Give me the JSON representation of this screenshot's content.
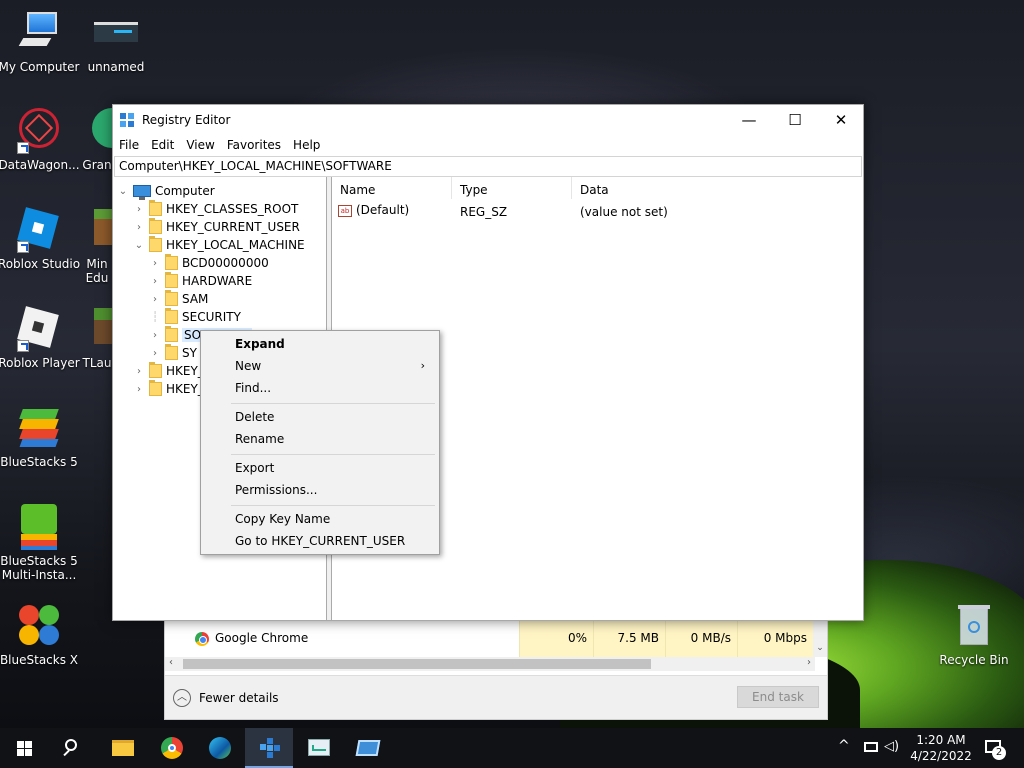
{
  "desktop": {
    "icons": [
      {
        "label": "My Computer"
      },
      {
        "label": "unnamed"
      },
      {
        "label": "DataWagon..."
      },
      {
        "label": "Gran"
      },
      {
        "label": "Roblox Studio"
      },
      {
        "label": "Min Edu"
      },
      {
        "label": "Roblox Player"
      },
      {
        "label": "TLau"
      },
      {
        "label": "BlueStacks 5"
      },
      {
        "label": "BlueStacks 5 Multi-Insta..."
      },
      {
        "label": "BlueStacks X"
      },
      {
        "label": "Recycle Bin"
      }
    ]
  },
  "task_manager": {
    "process_name": "Google Chrome",
    "cpu": "0%",
    "memory": "7.5 MB",
    "disk": "0 MB/s",
    "network": "0 Mbps",
    "fewer_details": "Fewer details",
    "end_task": "End task"
  },
  "regedit": {
    "title": "Registry Editor",
    "window_controls": {
      "minimize": "—",
      "maximize": "☐",
      "close": "✕"
    },
    "menu": [
      "File",
      "Edit",
      "View",
      "Favorites",
      "Help"
    ],
    "address": "Computer\\HKEY_LOCAL_MACHINE\\SOFTWARE",
    "tree": {
      "root": "Computer",
      "hives": [
        "HKEY_CLASSES_ROOT",
        "HKEY_CURRENT_USER",
        "HKEY_LOCAL_MACHINE"
      ],
      "hklm_children": [
        "BCD00000000",
        "HARDWARE",
        "SAM",
        "SECURITY",
        "SOFTWARE",
        "SY"
      ],
      "more_hives": [
        "HKEY_",
        "HKEY_"
      ]
    },
    "columns": [
      "Name",
      "Type",
      "Data"
    ],
    "values": [
      {
        "name": "(Default)",
        "type": "REG_SZ",
        "data": "(value not set)"
      }
    ]
  },
  "context_menu": {
    "items": [
      "Expand",
      "New",
      "Find...",
      "Delete",
      "Rename",
      "Export",
      "Permissions...",
      "Copy Key Name",
      "Go to HKEY_CURRENT_USER"
    ]
  },
  "taskbar": {
    "time": "1:20 AM",
    "date": "4/22/2022",
    "notification_count": "2"
  }
}
